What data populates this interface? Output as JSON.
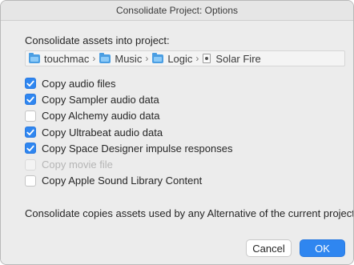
{
  "window": {
    "title": "Consolidate Project: Options"
  },
  "consolidate_label": "Consolidate assets into project:",
  "path": [
    {
      "label": "touchmac",
      "icon": "folder-icon"
    },
    {
      "label": "Music",
      "icon": "folder-icon"
    },
    {
      "label": "Logic",
      "icon": "folder-icon"
    },
    {
      "label": "Solar Fire",
      "icon": "logic-project-icon"
    }
  ],
  "path_separator": "›",
  "options": [
    {
      "label": "Copy audio files",
      "checked": true,
      "enabled": true
    },
    {
      "label": "Copy Sampler audio data",
      "checked": true,
      "enabled": true
    },
    {
      "label": "Copy Alchemy audio data",
      "checked": false,
      "enabled": true
    },
    {
      "label": "Copy Ultrabeat audio data",
      "checked": true,
      "enabled": true
    },
    {
      "label": "Copy Space Designer impulse responses",
      "checked": true,
      "enabled": true
    },
    {
      "label": "Copy movie file",
      "checked": false,
      "enabled": false
    },
    {
      "label": "Copy Apple Sound Library Content",
      "checked": false,
      "enabled": true
    }
  ],
  "footnote": "Consolidate copies assets used by any Alternative of the current project",
  "buttons": {
    "cancel": "Cancel",
    "ok": "OK"
  },
  "colors": {
    "accent": "#2f86f0",
    "window_bg": "#ececec",
    "folder": "#4a9ee3"
  }
}
